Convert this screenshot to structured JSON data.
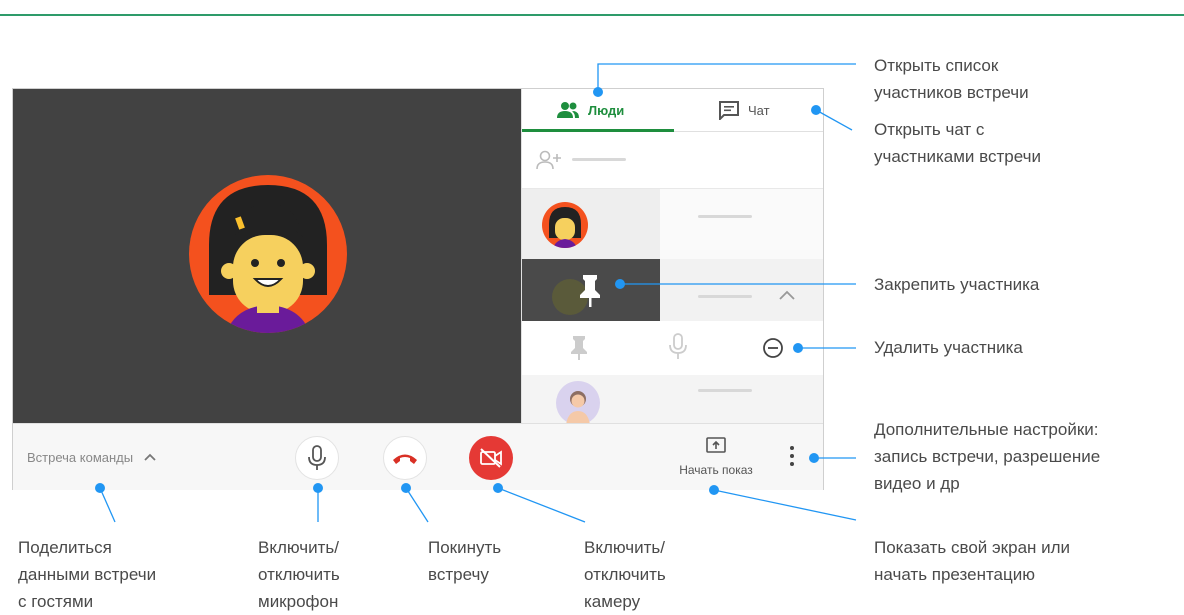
{
  "panel": {
    "tab_people": "Люди",
    "tab_chat": "Чат"
  },
  "bottom_bar": {
    "meeting_name": "Встреча команды",
    "present_label": "Начать показ"
  },
  "annotations": {
    "people_list": [
      "Открыть список",
      "участников встречи"
    ],
    "chat": [
      "Открыть чат с",
      "участниками встречи"
    ],
    "pin": [
      "Закрепить участника"
    ],
    "remove": [
      "Удалить участника"
    ],
    "more": [
      "Дополнительные настройки:",
      "запись встречи, разрешение",
      "видео и др"
    ],
    "present": [
      "Показать свой экран или",
      "начать презентацию"
    ],
    "share": [
      "Поделиться",
      "данными встречи",
      "с гостями"
    ],
    "mic": [
      "Включить/",
      "отключить",
      "микрофон"
    ],
    "leave": [
      "Покинуть",
      "встречу"
    ],
    "camera": [
      "Включить/",
      "отключить",
      "камеру"
    ]
  },
  "icons": {
    "people_tab": "people-icon",
    "chat_tab": "chat-icon",
    "add_person": "add-person-icon",
    "pin": "pin-icon",
    "mic": "microphone-icon",
    "remove": "remove-circle-icon",
    "leave": "hang-up-icon",
    "camera": "camera-off-icon",
    "present": "present-screen-icon",
    "more": "more-vert-icon",
    "chevron": "chevron-up-icon"
  },
  "colors": {
    "accent_green": "#1e8e3e",
    "annotation_blue": "#2196f3",
    "camera_red": "#e53935",
    "hangup_red": "#d93025",
    "video_bg": "#424242",
    "avatar_orange": "#f4511e"
  }
}
